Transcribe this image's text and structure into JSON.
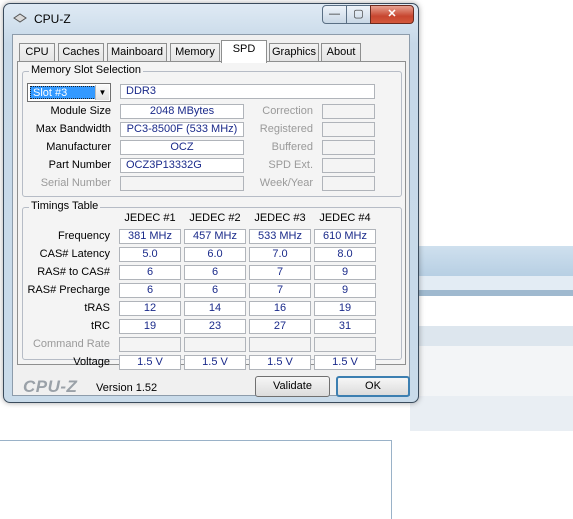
{
  "window": {
    "title": "CPU-Z",
    "min_glyph": "—",
    "max_glyph": "▢",
    "close_glyph": "✕"
  },
  "tabs": [
    {
      "label": "CPU"
    },
    {
      "label": "Caches"
    },
    {
      "label": "Mainboard"
    },
    {
      "label": "Memory"
    },
    {
      "label": "SPD",
      "active": true
    },
    {
      "label": "Graphics"
    },
    {
      "label": "About"
    }
  ],
  "slot": {
    "group_label": "Memory Slot Selection",
    "selected": "Slot #3",
    "type": "DDR3",
    "module_size_label": "Module Size",
    "module_size": "2048 MBytes",
    "max_bandwidth_label": "Max Bandwidth",
    "max_bandwidth": "PC3-8500F (533 MHz)",
    "manufacturer_label": "Manufacturer",
    "manufacturer": "OCZ",
    "part_number_label": "Part Number",
    "part_number": "OCZ3P13332G",
    "serial_number_label": "Serial Number",
    "serial_number": "",
    "correction_label": "Correction",
    "registered_label": "Registered",
    "buffered_label": "Buffered",
    "spd_ext_label": "SPD Ext.",
    "week_year_label": "Week/Year"
  },
  "timings": {
    "group_label": "Timings Table",
    "columns": [
      "JEDEC #1",
      "JEDEC #2",
      "JEDEC #3",
      "JEDEC #4"
    ],
    "rows": [
      {
        "label": "Frequency",
        "values": [
          "381 MHz",
          "457 MHz",
          "533 MHz",
          "610 MHz"
        ]
      },
      {
        "label": "CAS# Latency",
        "values": [
          "5.0",
          "6.0",
          "7.0",
          "8.0"
        ]
      },
      {
        "label": "RAS# to CAS#",
        "values": [
          "6",
          "6",
          "7",
          "9"
        ]
      },
      {
        "label": "RAS# Precharge",
        "values": [
          "6",
          "6",
          "7",
          "9"
        ]
      },
      {
        "label": "tRAS",
        "values": [
          "12",
          "14",
          "16",
          "19"
        ]
      },
      {
        "label": "tRC",
        "values": [
          "19",
          "23",
          "27",
          "31"
        ]
      },
      {
        "label": "Command Rate",
        "values": [
          "",
          "",
          "",
          ""
        ],
        "dim": true
      },
      {
        "label": "Voltage",
        "values": [
          "1.5 V",
          "1.5 V",
          "1.5 V",
          "1.5 V"
        ]
      }
    ]
  },
  "footer": {
    "logo": "CPU-Z",
    "version": "Version 1.52",
    "validate_label": "Validate",
    "ok_label": "OK"
  }
}
